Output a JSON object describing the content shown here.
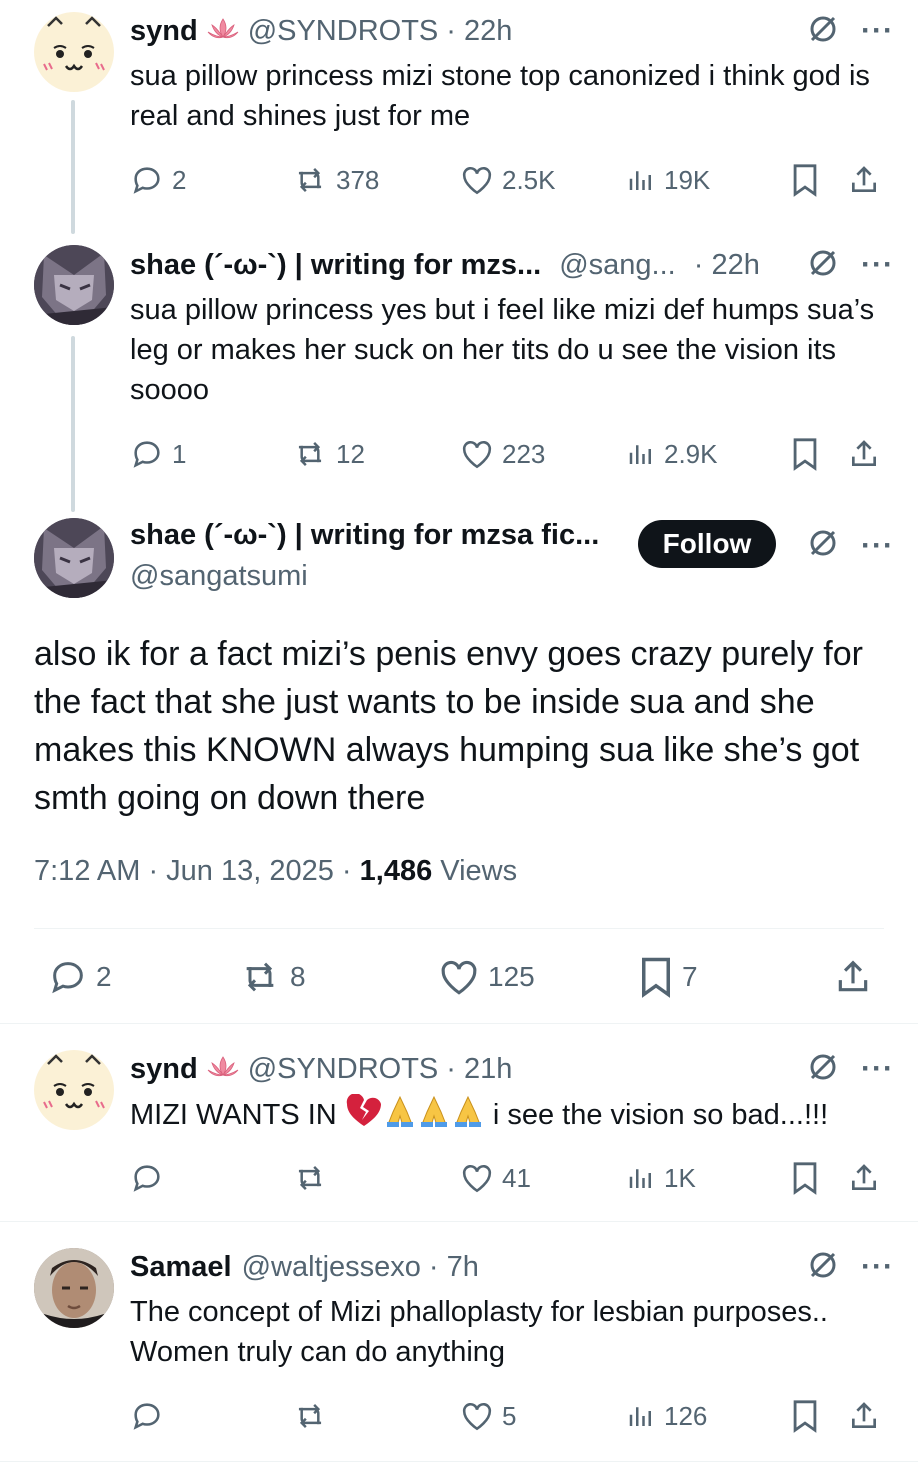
{
  "colors": {
    "text": "#0f1419",
    "muted": "#536471",
    "line": "#cfd9de",
    "follow_bg": "#0f1419",
    "heart_emoji": "#d4213d"
  },
  "icons": [
    "avatar",
    "lotus-badge-icon",
    "grok-icon",
    "more-icon",
    "reply-icon",
    "repost-icon",
    "like-icon",
    "views-icon",
    "bookmark-icon",
    "share-icon",
    "broken-heart-emoji",
    "folded-hands-emoji"
  ],
  "reply1": {
    "name": "synd",
    "handle": "@SYNDROTS",
    "time": "· 22h",
    "text": "sua pillow princess mizi stone top canonized i think god is real and shines just for me",
    "replies": "2",
    "reposts": "378",
    "likes": "2.5K",
    "views": "19K"
  },
  "reply2": {
    "name": "shae (´-ω-`) | writing for mzs...",
    "handle": "@sang...",
    "time": "· 22h",
    "text": "sua pillow princess yes but i feel like mizi def humps sua’s leg or makes her suck on her tits do u see the vision its soooo",
    "replies": "1",
    "reposts": "12",
    "likes": "223",
    "views": "2.9K"
  },
  "main": {
    "name": "shae (´-ω-`) | writing for mzsa fic...",
    "handle": "@sangatsumi",
    "follow_label": "Follow",
    "text": "also ik for a fact mizi’s penis envy goes crazy purely for the fact that she just wants to be inside sua and she makes this KNOWN always humping sua like she’s got smth going on down there",
    "time": "7:12 AM · Jun 13, 2025 · ",
    "views_count": "1,486",
    "views_label": " Views",
    "replies": "2",
    "reposts": "8",
    "likes": "125",
    "bookmarks": "7"
  },
  "reply3": {
    "name": "synd",
    "handle": "@SYNDROTS",
    "time": "· 21h",
    "text_before": "MIZI WANTS IN ",
    "text_after": " i see the vision so bad...!!!",
    "likes": "41",
    "views": "1K"
  },
  "reply4": {
    "name": "Samael",
    "handle": "@waltjessexo",
    "time": "· 7h",
    "text": "The concept of Mizi phalloplasty for lesbian purposes.. Women truly can do anything",
    "likes": "5",
    "views": "126"
  }
}
